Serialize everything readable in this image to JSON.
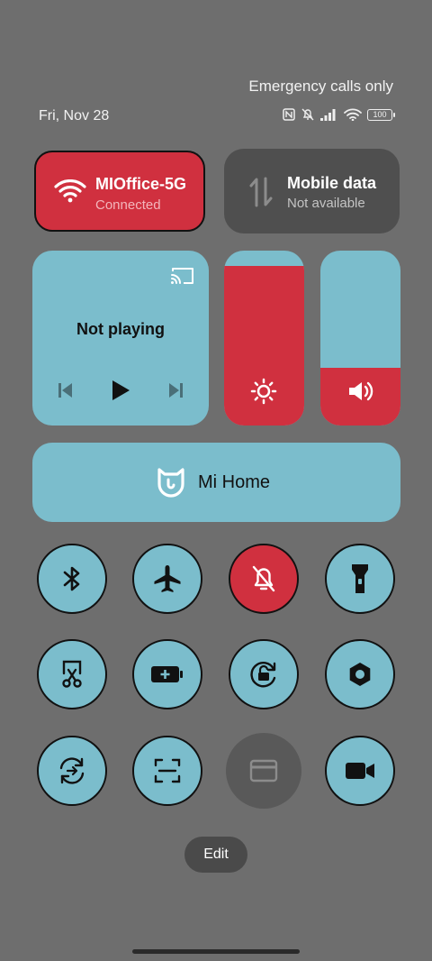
{
  "status_bar": {
    "emergency": "Emergency calls only",
    "date": "Fri, Nov 28",
    "battery": "100",
    "icons": [
      "nfc-icon",
      "silent-icon",
      "signal-icon",
      "wifi-icon",
      "battery-icon"
    ]
  },
  "wifi_tile": {
    "title": "MIOffice-5G",
    "subtitle": "Connected",
    "icon": "wifi-icon"
  },
  "mobile_tile": {
    "title": "Mobile data",
    "subtitle": "Not available",
    "icon": "mobile-data-icon"
  },
  "media": {
    "status": "Not playing",
    "icons": [
      "cast-icon",
      "previous-icon",
      "play-icon",
      "next-icon"
    ]
  },
  "brightness": {
    "level": 0.91,
    "icon": "brightness-icon"
  },
  "volume": {
    "level": 0.33,
    "icon": "volume-icon"
  },
  "mi_home": {
    "label": "Mi Home",
    "icon": "mi-home-icon"
  },
  "toggles": [
    {
      "name": "bluetooth",
      "state": "off"
    },
    {
      "name": "airplane-mode",
      "state": "off"
    },
    {
      "name": "silent-mode",
      "state": "on"
    },
    {
      "name": "flashlight",
      "state": "off"
    },
    {
      "name": "screenshot",
      "state": "off"
    },
    {
      "name": "battery-saver",
      "state": "off"
    },
    {
      "name": "rotation-lock",
      "state": "off"
    },
    {
      "name": "settings",
      "state": "off"
    },
    {
      "name": "sync",
      "state": "off"
    },
    {
      "name": "scanner",
      "state": "off"
    },
    {
      "name": "wallet",
      "state": "unavailable"
    },
    {
      "name": "screen-recorder",
      "state": "off"
    }
  ],
  "edit": "Edit",
  "colors": {
    "accent": "#d0303f",
    "tile": "#7bbdcc",
    "background": "#6e6e6e"
  }
}
